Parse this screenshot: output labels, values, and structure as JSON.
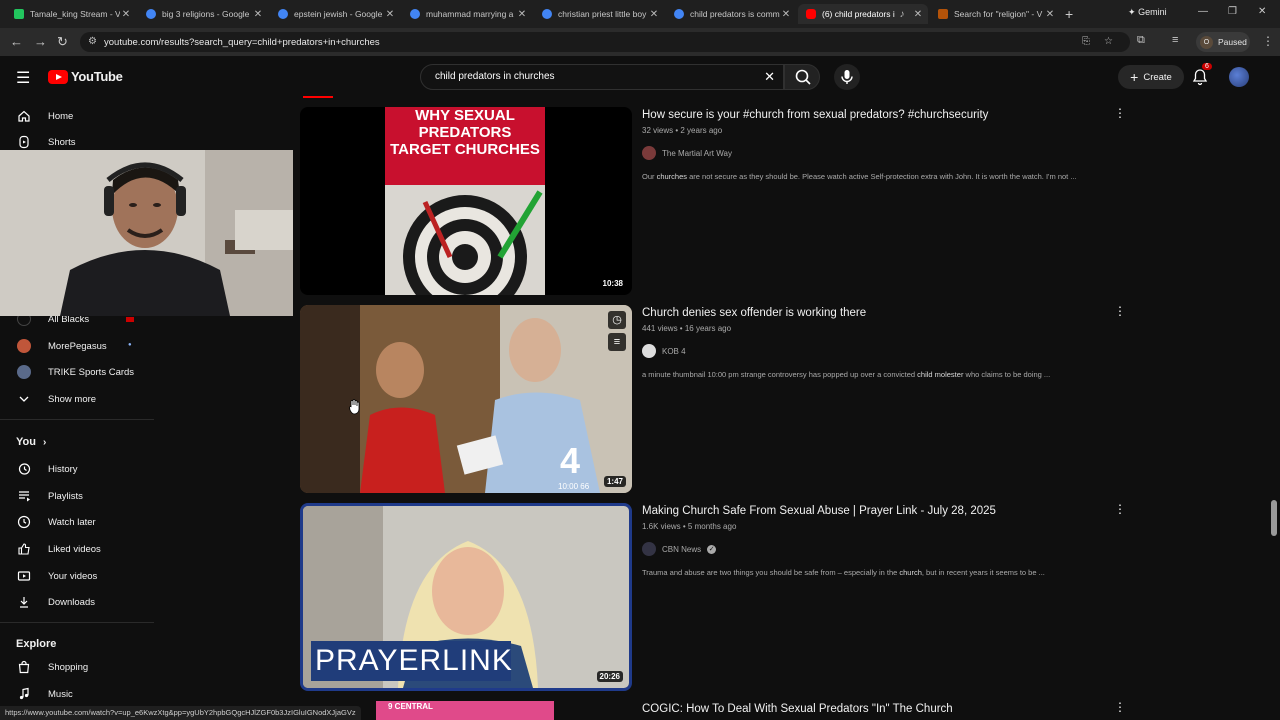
{
  "browser": {
    "tabs": [
      {
        "title": "Tamale_king Stream - V",
        "fav_color": "#22c55e"
      },
      {
        "title": "big 3 religions - Google",
        "fav_color": "#4285f4"
      },
      {
        "title": "epstein jewish - Google",
        "fav_color": "#4285f4"
      },
      {
        "title": "muhammad marrying a",
        "fav_color": "#4285f4"
      },
      {
        "title": "christian priest little boy",
        "fav_color": "#4285f4"
      },
      {
        "title": "child predators is comm",
        "fav_color": "#4285f4"
      },
      {
        "title": "(6) child predators i",
        "fav_color": "#ff0000"
      },
      {
        "title": "Search for \"religion\" - V",
        "fav_color": "#b45309"
      }
    ],
    "new_tab": "+",
    "gemini_label": "Gemini",
    "url": "youtube.com/results?search_query=child+predators+in+churches",
    "profile_status": "Paused",
    "profile_initial": "O",
    "status_url": "https://www.youtube.com/watch?v=up_e6KwzXtg&pp=ygUbY2hpbGQgcHJlZGF0b3JzIGluIGNodXJjaGVz"
  },
  "youtube": {
    "logo_text": "YouTube",
    "search_value": "child predators in churches",
    "create_label": "Create",
    "notification_count": "6"
  },
  "sidebar": {
    "top": [
      {
        "label": "Home",
        "icon": "home-icon"
      },
      {
        "label": "Shorts",
        "icon": "shorts-icon"
      }
    ],
    "subscriptions": [
      {
        "label": "All Blacks",
        "avatar_color": "#111111"
      },
      {
        "label": "MorePegasus",
        "avatar_color": "#c0563a"
      },
      {
        "label": "TRIKE Sports Cards",
        "avatar_color": "#5a6a8a"
      }
    ],
    "show_more": "Show more",
    "you_label": "You",
    "you_items": [
      {
        "label": "History",
        "icon": "history-icon"
      },
      {
        "label": "Playlists",
        "icon": "playlists-icon"
      },
      {
        "label": "Watch later",
        "icon": "watch-later-icon"
      },
      {
        "label": "Liked videos",
        "icon": "thumbs-up-icon"
      },
      {
        "label": "Your videos",
        "icon": "your-videos-icon"
      },
      {
        "label": "Downloads",
        "icon": "download-icon"
      }
    ],
    "explore_label": "Explore",
    "explore_items": [
      {
        "label": "Shopping",
        "icon": "shopping-bag-icon"
      },
      {
        "label": "Music",
        "icon": "music-note-icon"
      }
    ]
  },
  "results": [
    {
      "title": "How secure is your #church from sexual predators? #churchsecurity",
      "meta": "32 views • 2 years ago",
      "channel": "The Martial Art Way",
      "desc_pre": "Our ",
      "desc_bold": "churches",
      "desc_post": " are not secure as they should be. Please watch active Self-protection extra with John. It is worth the watch. I'm not ...",
      "duration": "10:38",
      "thumb_text": "WHY SEXUAL PREDATORS TARGET CHURCHES"
    },
    {
      "title": "Church denies sex offender is working there",
      "meta": "441 views • 16 years ago",
      "channel": "KOB 4",
      "desc_pre": "a minute thumbnail 10:00 pm strange controversy has popped up over a convicted ",
      "desc_bold": "child molester",
      "desc_post": " who claims to be doing ...",
      "duration": "1:47",
      "thumb_text": "4",
      "thumb_clock": "10:00 66"
    },
    {
      "title": "Making Church Safe From Sexual Abuse | Prayer Link - July 28, 2025",
      "meta": "1.6K views • 5 months ago",
      "channel": "CBN News",
      "desc_pre": "Trauma and abuse are two things you should be safe from – especially in the ",
      "desc_bold": "church",
      "desc_post": ", but in recent years it seems to be ...",
      "duration": "20:26",
      "thumb_text": "PRAYERLINK"
    },
    {
      "title": "COGIC: How To Deal With Sexual Predators \"In\" The Church",
      "thumb_text": "9 CENTRAL"
    }
  ]
}
